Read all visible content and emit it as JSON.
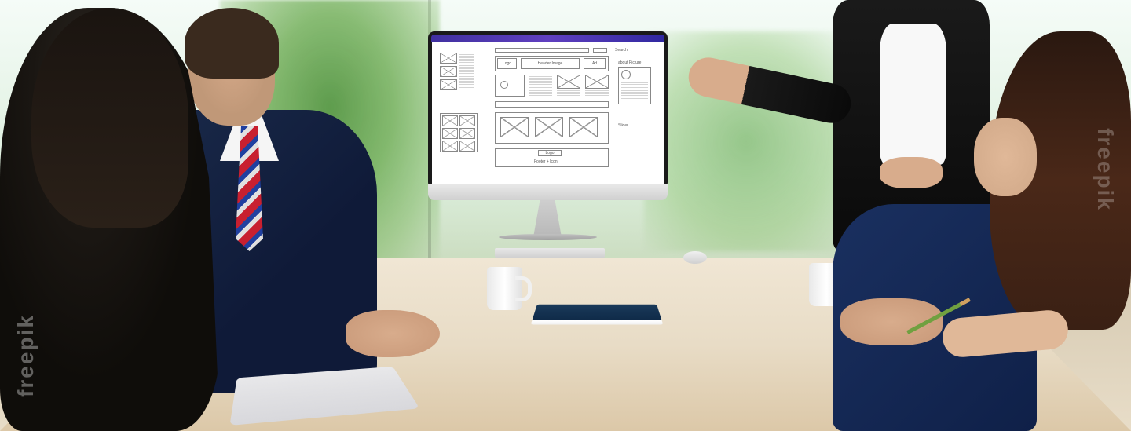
{
  "scene": {
    "watermark": "freepik"
  },
  "wireframe": {
    "header": {
      "logo": "Logo",
      "image": "Header Image",
      "ad": "Ad"
    },
    "labels": {
      "search": "Search",
      "slider": "Slider",
      "about_picture": "about Picture"
    },
    "footer": {
      "logo": "Logo",
      "label": "Footer + Icon"
    }
  }
}
